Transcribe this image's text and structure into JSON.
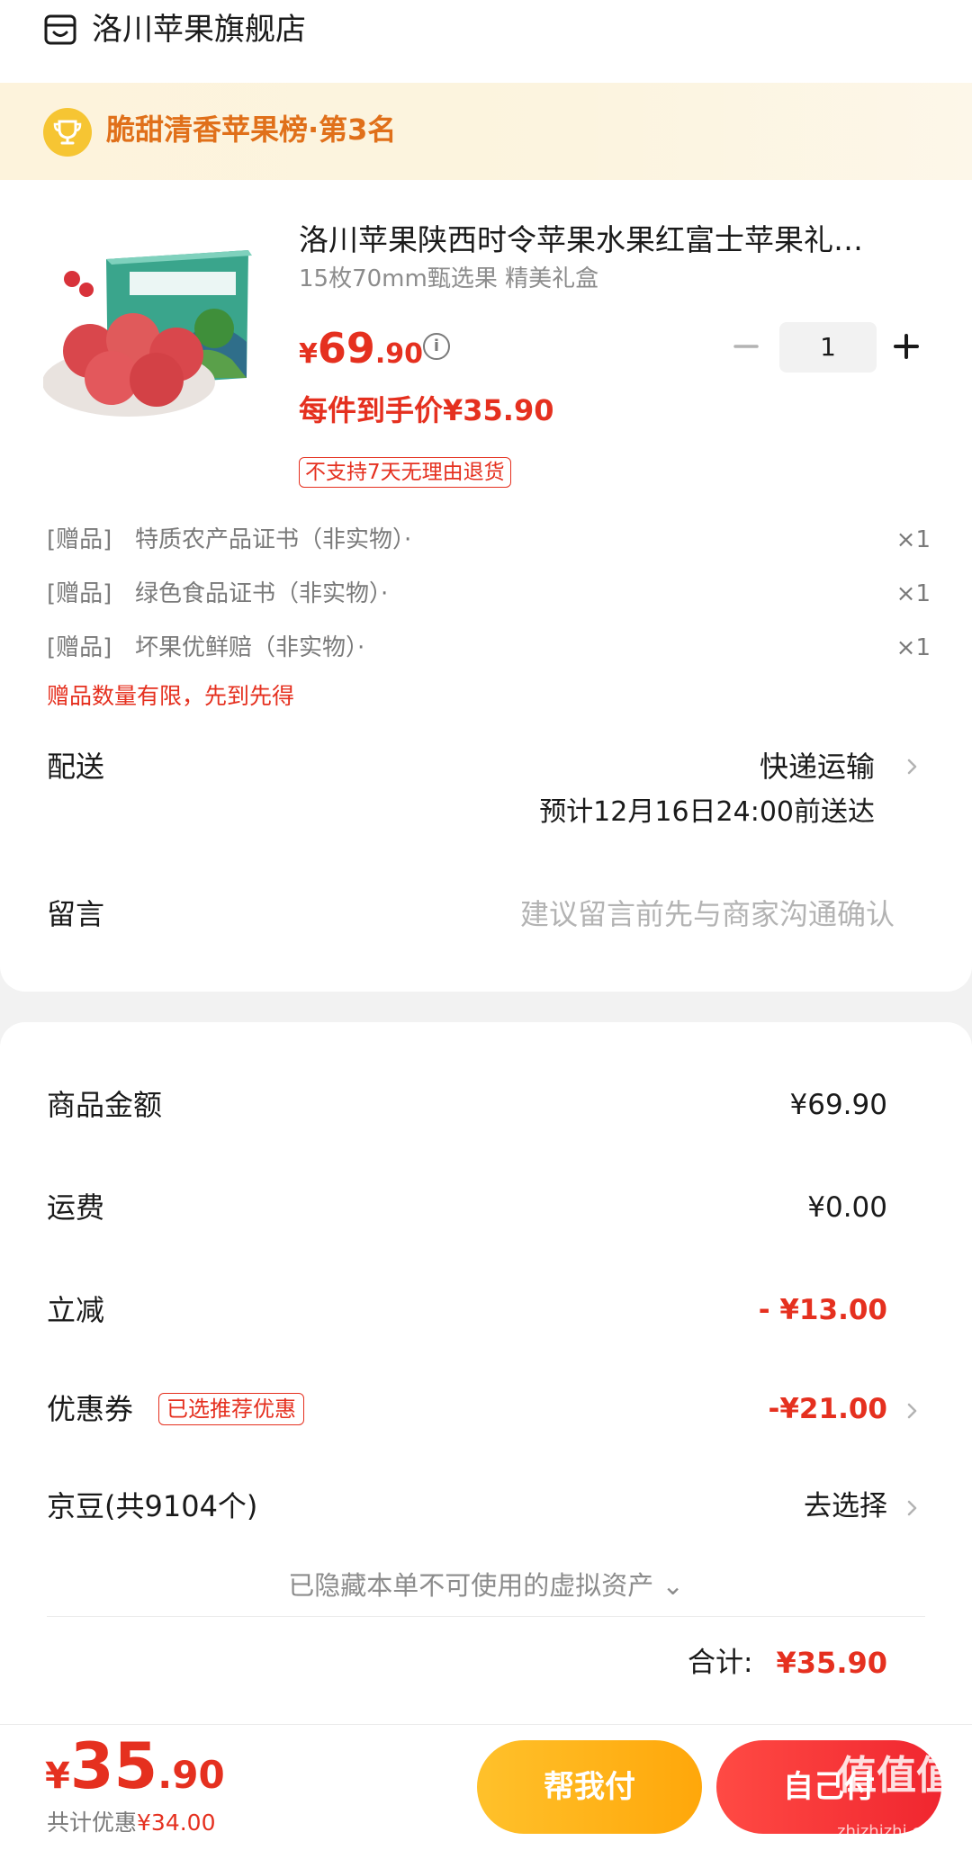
{
  "store": {
    "name": "洛川苹果旗舰店"
  },
  "rank": {
    "text": "脆甜清香苹果榜·第3名"
  },
  "product": {
    "title": "洛川苹果陕西时令苹果水果红富士苹果礼…",
    "spec": "15枚70mm甄选果 精美礼盒",
    "price_currency": "¥",
    "price_int": "69",
    "price_dec": ".90",
    "quantity": "1",
    "final_price": "每件到手价¥35.90",
    "return_tag": "不支持7天无理由退货"
  },
  "gifts": [
    {
      "tag": "[赠品]",
      "name": "特质农产品证书（非实物）·",
      "qty": "×1"
    },
    {
      "tag": "[赠品]",
      "name": "绿色食品证书（非实物）·",
      "qty": "×1"
    },
    {
      "tag": "[赠品]",
      "name": "坏果优鲜赔（非实物）·",
      "qty": "×1"
    }
  ],
  "gift_note": "赠品数量有限，先到先得",
  "delivery": {
    "label": "配送",
    "method": "快递运输",
    "eta": "预计12月16日24:00前送达"
  },
  "message": {
    "label": "留言",
    "placeholder": "建议留言前先与商家沟通确认"
  },
  "summary": {
    "goods_label": "商品金额",
    "goods_value": "¥69.90",
    "freight_label": "运费",
    "freight_value": "¥0.00",
    "discount_label": "立减",
    "discount_value": "- ¥13.00",
    "coupon_label": "优惠券",
    "coupon_tag": "已选推荐优惠",
    "coupon_value": "-¥21.00",
    "beans_label": "京豆(共9104个)",
    "beans_value": "去选择",
    "hidden_assets": "已隐藏本单不可使用的虚拟资产 ⌄",
    "total_label": "合计:",
    "total_value": "¥35.90"
  },
  "bottom": {
    "price_currency": "¥",
    "price_int": "35",
    "price_dec": ".90",
    "saving_prefix": "共计优惠",
    "saving_amount": "¥34.00",
    "help_pay": "帮我付",
    "self_pay": "自己付"
  },
  "watermark": {
    "main": "值值值",
    "sub": "zhizhizhi.com"
  },
  "colors": {
    "accent_red": "#e5301f",
    "gold": "#ffb01a",
    "rank_orange": "#e0701a"
  }
}
